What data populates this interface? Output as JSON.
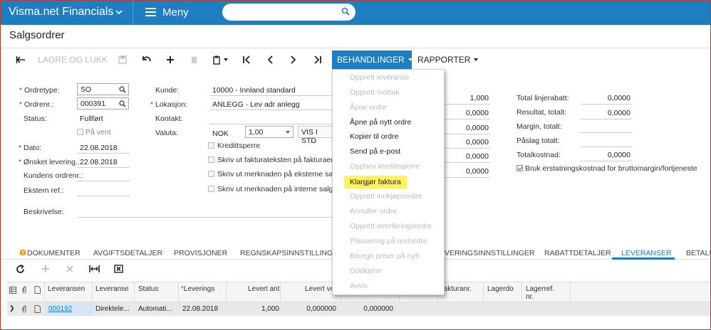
{
  "topbar": {
    "app_title": "Visma.net Financials",
    "menu_label": "Meny",
    "search_placeholder": ""
  },
  "page": {
    "title": "Salgsordrer"
  },
  "toolbar": {
    "save_close_label": "LAGRE OG LUKK",
    "actions_label": "BEHANDLINGER",
    "reports_label": "RAPPORTER"
  },
  "form": {
    "order_type_label": "Ordretype:",
    "order_type_value": "SO",
    "order_nr_label": "Ordrenr.:",
    "order_nr_value": "000391",
    "status_label": "Status:",
    "status_value": "Fullført",
    "on_hold_label": "På vent",
    "date_label": "Dato:",
    "date_value": "22.08.2018",
    "requested_label": "Ønsket levering...",
    "requested_value": "22.08.2018",
    "customer_order_label": "Kundens ordrenr.:",
    "external_ref_label": "Ekstern ref.:",
    "description_label": "Beskrivelse:",
    "customer_label": "Kunde:",
    "customer_value": "10000 - Innland standard",
    "location_label": "Lokasjon:",
    "location_value": "ANLEGG - Lev adr anlegg",
    "contact_label": "Kontakt:",
    "currency_label": "Valuta:",
    "currency_value": "NOK",
    "rate_value": "1,00",
    "view_button": "VIS I STD",
    "credit_block_label": "Kredittsperre",
    "print_invoice_text_label": "Skriv ut fakturateksten på fakturaen",
    "print_ext_note_label": "Skriv ut merknaden på eksterne salgsdo",
    "print_int_note_label": "Skriv ut merknaden på interne salgsdoku"
  },
  "totals": {
    "col1": [
      "1,000",
      "0,0000",
      "0,0000",
      "0,0000",
      "0,0000",
      "0,0000"
    ],
    "total_line_discount_label": "Total linjerabatt:",
    "total_line_discount_value": "0,0000",
    "result_total_label": "Resultat, totalt:",
    "result_total_value": "0,0000",
    "margin_total_label": "Margin, totalt:",
    "markup_total_label": "Påslag totalt:",
    "total_cost_label": "Totalkostnad:",
    "total_cost_value": "0,0000",
    "use_replacement_cost_label": "Bruk erstatningskostnad for bruttomargin/fortjeneste"
  },
  "tabs": [
    "DOKUMENTER",
    "AVGIFTSDETALJER",
    "PROVISJONER",
    "REGNSKAPSINNSTILLINGER",
    "LEVERINGSINNSTILLINGER",
    "RABATTDETALJER",
    "LEVERANSER",
    "BETALIN"
  ],
  "grid": {
    "headers": [
      "Leveransen",
      "Leveranse",
      "Status",
      "Leverings",
      "Levert ant.",
      "Levert ve",
      "fakturanr.",
      "Lagerdo",
      "Lagerref.",
      "nr."
    ],
    "row": {
      "shipment": "000192",
      "type": "Direktele...",
      "status": "Automati...",
      "date": "22.08.2018",
      "qty": "1,000",
      "value1": "0,000000",
      "value2": "0,000000"
    }
  },
  "actions_menu": {
    "items": [
      {
        "label": "Opprett leveranse",
        "enabled": false
      },
      {
        "label": "Opprett mottak",
        "enabled": false
      },
      {
        "label": "Åpne ordre",
        "enabled": false
      },
      {
        "label": "Åpne på nytt ordre",
        "enabled": true
      },
      {
        "label": "Kopier til ordre",
        "enabled": true
      },
      {
        "label": "Send på e-post",
        "enabled": true
      },
      {
        "label": "Opphev kredittsperre",
        "enabled": false
      },
      {
        "label": "Klargjør faktura",
        "enabled": true,
        "highlighted": true
      },
      {
        "label": "Opprett innkjøpsordre",
        "enabled": false
      },
      {
        "label": "Annuller ordre",
        "enabled": false
      },
      {
        "label": "Opprett overføringsordre",
        "enabled": false
      },
      {
        "label": "Plassering på restordre",
        "enabled": false
      },
      {
        "label": "Beregn priser på nytt",
        "enabled": false
      },
      {
        "label": "Godkjenn",
        "enabled": false
      },
      {
        "label": "Avvis",
        "enabled": false
      }
    ]
  },
  "colors": {
    "brand": "#1f7dc2",
    "highlight": "#fff25a"
  }
}
